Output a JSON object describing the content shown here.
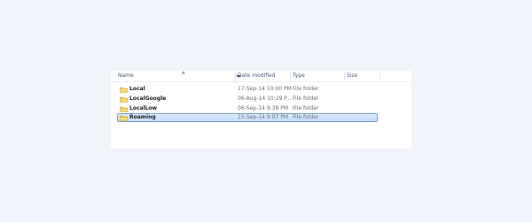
{
  "columns": {
    "name": "Name",
    "date": "Date modified",
    "type": "Type",
    "size": "Size"
  },
  "rows": [
    {
      "name": "Local",
      "date": "17-Sep-14 10:00 PM",
      "type": "File folder",
      "size": ""
    },
    {
      "name": "LocalGoogle",
      "date": "06-Aug-14 10:29 P...",
      "type": "File folder",
      "size": ""
    },
    {
      "name": "LocalLow",
      "date": "06-Sep-14 9:38 PM",
      "type": "File folder",
      "size": ""
    },
    {
      "name": "Roaming",
      "date": "15-Sep-14 9:07 PM",
      "type": "File folder",
      "size": ""
    }
  ],
  "selected_row": "Roaming",
  "colors": {
    "background": "#f0f3f9",
    "selection": "#c9e0fb",
    "folder": "#f2c94c"
  }
}
